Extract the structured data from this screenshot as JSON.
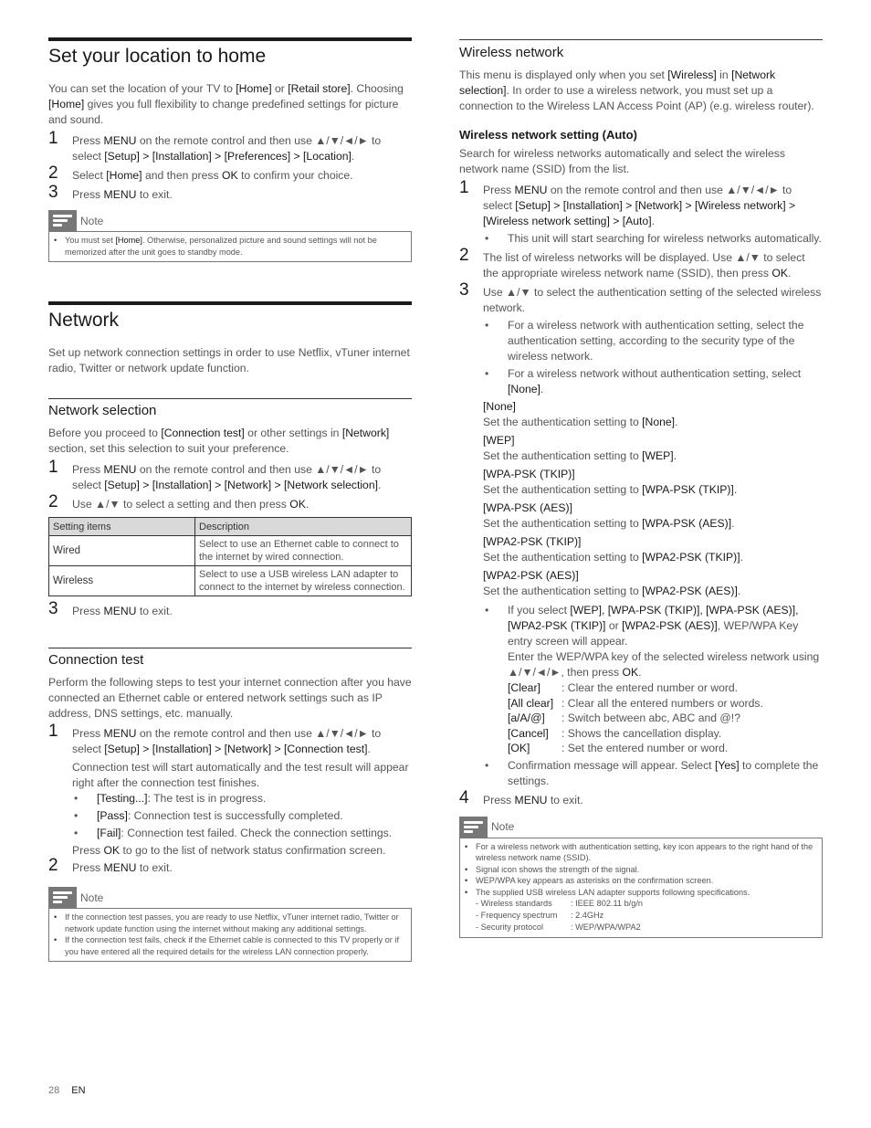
{
  "location": {
    "title": "Set your location to home",
    "intro_1": "You can set the location of your TV to ",
    "home": "[Home]",
    "or": " or ",
    "retail": "[Retail store]",
    "intro_2": ". Choosing ",
    "intro_3": " gives you full flexibility to change predefined settings for picture and sound.",
    "steps": [
      {
        "num": "1",
        "pre": "Press ",
        "key": "MENU",
        "mid": " on the remote control and then use ▲/▼/◄/► to select ",
        "path": "[Setup] > [Installation] > [Preferences] > [Location]",
        "post": "."
      },
      {
        "num": "2",
        "pre": "Select ",
        "key": "[Home]",
        "mid": " and then press ",
        "key2": "OK",
        "post": " to confirm your choice."
      },
      {
        "num": "3",
        "pre": "Press ",
        "key": "MENU",
        "post": " to exit."
      }
    ],
    "note": {
      "label": "Note",
      "items": [
        {
          "pre": "You must set ",
          "key": "[Home]",
          "post": ". Otherwise, personalized picture and sound settings will not be memorized after the unit goes to standby mode."
        }
      ]
    }
  },
  "network": {
    "title": "Network",
    "intro": "Set up network connection settings in order to use Netflix, vTuner internet radio, Twitter or network update function."
  },
  "network_selection": {
    "title": "Network selection",
    "intro_pre": "Before you proceed to ",
    "intro_k1": "[Connection test]",
    "intro_mid": " or other settings in ",
    "intro_k2": "[Network]",
    "intro_post": " section, set this selection to suit your preference.",
    "steps": [
      {
        "num": "1",
        "pre": "Press ",
        "key": "MENU",
        "mid": " on the remote control and then use ▲/▼/◄/► to select ",
        "path": "[Setup] > [Installation] > [Network] > [Network selection]",
        "post": "."
      },
      {
        "num": "2",
        "pre": "Use ▲/▼ to select a setting and then press ",
        "key": "OK",
        "post": "."
      },
      {
        "num": "3",
        "pre": "Press ",
        "key": "MENU",
        "post": " to exit."
      }
    ],
    "table": {
      "headers": [
        "Setting items",
        "Description"
      ],
      "rows": [
        [
          "Wired",
          "Select to use an Ethernet cable to connect to the internet by wired connection."
        ],
        [
          "Wireless",
          "Select to use a USB wireless LAN adapter to connect to the internet by wireless connection."
        ]
      ]
    }
  },
  "connection_test": {
    "title": "Connection test",
    "intro": "Perform the following steps to test your internet connection after you have connected an Ethernet cable or entered network settings such as IP address, DNS settings, etc. manually.",
    "step1": {
      "num": "1",
      "pre": "Press ",
      "key": "MENU",
      "mid": " on the remote control and then use ▲/▼/◄/► to select ",
      "path": "[Setup] > [Installation] > [Network] > [Connection test]",
      "post": "."
    },
    "step1_detail": "Connection test will start automatically and the test result will appear right after the connection test finishes.",
    "results": [
      {
        "key": "[Testing...]",
        "text": ": The test is in progress."
      },
      {
        "key": "[Pass]",
        "text": ": Connection test is successfully completed."
      },
      {
        "key": "[Fail]",
        "text": ": Connection test failed. Check the connection settings."
      }
    ],
    "ok_pre": "Press ",
    "ok_key": "OK",
    "ok_post": " to go to the list of network status confirmation screen.",
    "step2": {
      "num": "2",
      "pre": "Press ",
      "key": "MENU",
      "post": " to exit."
    },
    "note": {
      "label": "Note",
      "items": [
        "If the connection test passes, you are ready to use Netflix, vTuner internet radio, Twitter or network update function using the internet without making any additional settings.",
        "If the connection test fails, check if the Ethernet cable is connected to this TV properly or if you have entered all the required details for the wireless LAN connection properly."
      ]
    }
  },
  "wireless": {
    "title": "Wireless network",
    "intro_pre": "This menu is displayed only when you set ",
    "intro_k1": "[Wireless]",
    "intro_mid": " in ",
    "intro_k2": "[Network selection]",
    "intro_post": ". In order to use a wireless network, you must set up a connection to the Wireless LAN Access Point (AP) (e.g. wireless router).",
    "auto_title": "Wireless network setting (Auto)",
    "auto_intro": "Search for wireless networks automatically and select the wireless network name (SSID) from the list.",
    "step1": {
      "num": "1",
      "pre": "Press ",
      "key": "MENU",
      "mid": " on the remote control and then use ▲/▼/◄/► to select ",
      "path": "[Setup] > [Installation] > [Network] > [Wireless network] > [Wireless network setting] > [Auto]",
      "post": "."
    },
    "step1_bullet": "This unit will start searching for wireless networks automatically.",
    "step2": {
      "num": "2",
      "pre": "The list of wireless networks will be displayed. Use ▲/▼ to select the appropriate wireless network name (SSID), then press ",
      "key": "OK",
      "post": "."
    },
    "step3": {
      "num": "3",
      "text": "Use ▲/▼ to select the authentication setting of the selected wireless network."
    },
    "step3_bullets": [
      {
        "pre": "For a wireless network with authentication setting, select the authentication setting, according to the security type of the wireless network.",
        "key": "",
        "post": ""
      },
      {
        "pre": "For a wireless network without authentication setting, select ",
        "key": "[None]",
        "post": "."
      }
    ],
    "auth_prefix": "Set the authentication setting to ",
    "auth_options": [
      {
        "label": "[None]"
      },
      {
        "label": "[WEP]"
      },
      {
        "label": "[WPA-PSK (TKIP)]"
      },
      {
        "label": "[WPA-PSK (AES)]"
      },
      {
        "label": "[WPA2-PSK (TKIP)]"
      },
      {
        "label": "[WPA2-PSK (AES)]"
      }
    ],
    "key_bullet": {
      "pre": "If you select ",
      "keys": "[WEP], [WPA-PSK (TKIP)], [WPA-PSK (AES)], [WPA2-PSK (TKIP)]",
      "or": " or ",
      "last": "[WPA2-PSK (AES)]",
      "post": ", WEP/WPA Key entry screen will appear.",
      "enter_pre": "Enter the WEP/WPA key of the selected wireless network using ▲/▼/◄/►, then press ",
      "enter_key": "OK",
      "enter_post": "."
    },
    "key_functions": [
      {
        "key": "[Clear]",
        "desc": ": Clear the entered number or word."
      },
      {
        "key": "[All clear]",
        "desc": ": Clear all the entered numbers or words."
      },
      {
        "key": "[a/A/@]",
        "desc": ": Switch between abc, ABC and @!?"
      },
      {
        "key": "[Cancel]",
        "desc": ": Shows the cancellation display."
      },
      {
        "key": "[OK]",
        "desc": ": Set the entered number or word."
      }
    ],
    "confirm_bullet": {
      "pre": "Confirmation message will appear. Select ",
      "key": "[Yes]",
      "post": " to complete the settings."
    },
    "step4": {
      "num": "4",
      "pre": "Press ",
      "key": "MENU",
      "post": " to exit."
    },
    "note": {
      "label": "Note",
      "items": [
        "For a wireless network with authentication setting, key icon appears to the right hand of the wireless network name (SSID).",
        "Signal icon shows the strength of the signal.",
        "WEP/WPA key appears as asterisks on the confirmation screen.",
        "The supplied USB wireless LAN adapter supports following specifications."
      ],
      "specs": [
        {
          "k": "- Wireless standards",
          "v": ": IEEE 802.11 b/g/n"
        },
        {
          "k": "- Frequency spectrum",
          "v": ": 2.4GHz"
        },
        {
          "k": "- Security protocol",
          "v": ": WEP/WPA/WPA2"
        }
      ]
    }
  },
  "footer": {
    "page": "28",
    "lang": "EN"
  }
}
